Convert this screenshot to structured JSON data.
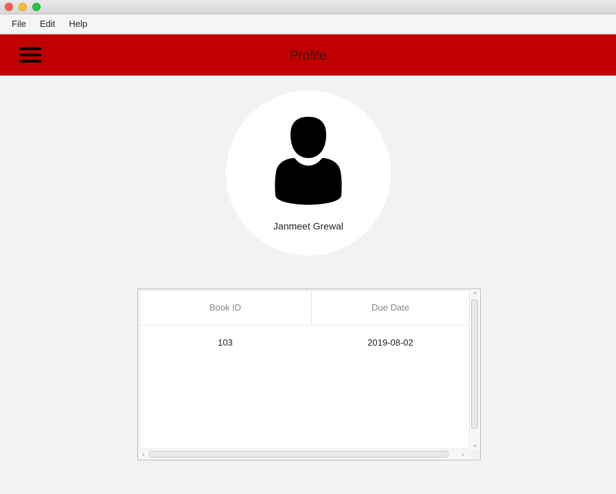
{
  "window": {
    "traffic_lights": [
      "close",
      "minimize",
      "zoom"
    ]
  },
  "menubar": {
    "items": [
      {
        "label": "File"
      },
      {
        "label": "Edit"
      },
      {
        "label": "Help"
      }
    ]
  },
  "header": {
    "title": "Profile",
    "menu_icon": "hamburger-menu-icon",
    "background_color": "#c00000"
  },
  "profile": {
    "avatar_icon": "user-silhouette-icon",
    "name": "Janmeet Grewal"
  },
  "table": {
    "columns": [
      "Book ID",
      "Due Date"
    ],
    "rows": [
      [
        "103",
        "2019-08-02"
      ]
    ]
  }
}
